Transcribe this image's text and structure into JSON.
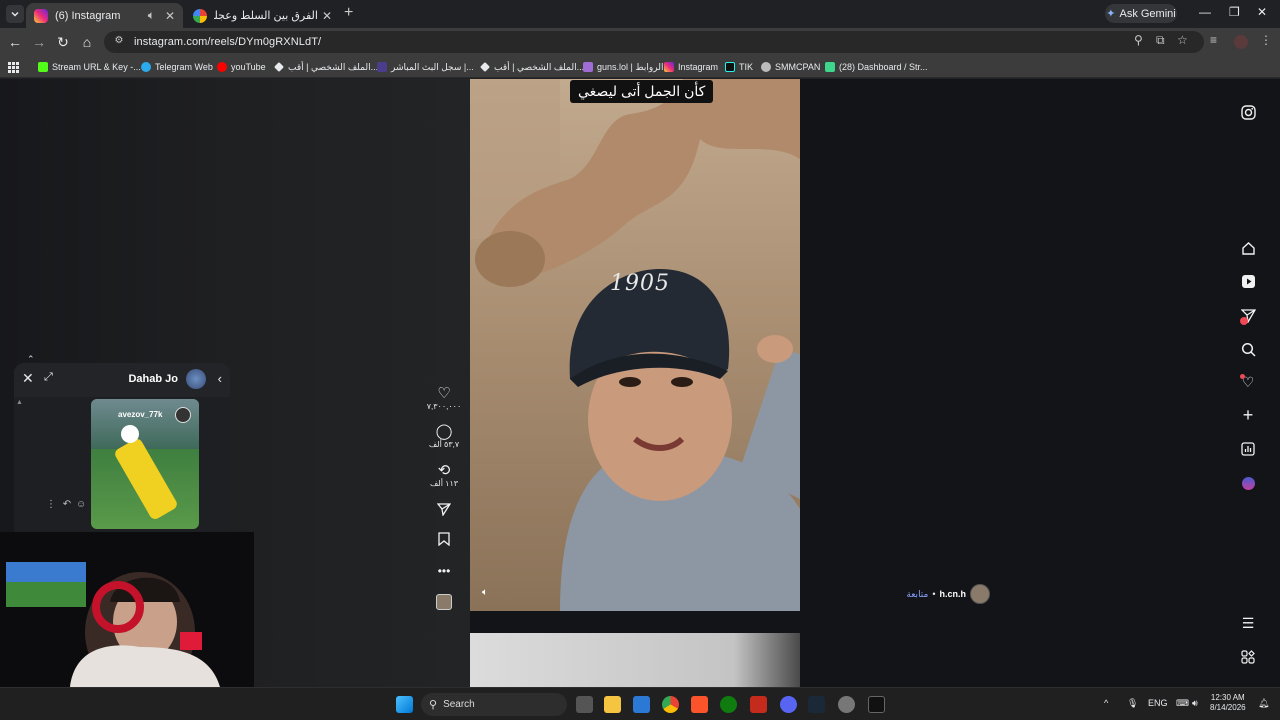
{
  "browser": {
    "tabs": [
      {
        "title": "(6) Instagram",
        "active": true
      },
      {
        "title": "الفرق بين السلط وعجلون - بحث",
        "active": false
      }
    ],
    "ask_gemini": "Ask Gemini",
    "url": "instagram.com/reels/DYm0gRXNLdT/",
    "bookmarks": [
      "Stream URL & Key -...",
      "Telegram Web",
      "youTube",
      "الملف الشخصي | أقب...",
      "سجل البث المباشر |...",
      "الملف الشخصي | أقب...",
      "guns.lol | الروابط",
      "Instagram",
      "TIK",
      "SMMCPAN",
      "(28) Dashboard / Str..."
    ]
  },
  "reel": {
    "caption": "كأن الجمل أتى ليصغي",
    "cap_logo": "1905",
    "actions": {
      "likes": "٧,٣٠٠,٠٠٠",
      "comments": "٥٣,٧ ألف",
      "reposts": "١١٣ ألف"
    },
    "author": {
      "name": "h.cn.h",
      "separator": "•",
      "follow": "متابعة"
    }
  },
  "chat": {
    "title": "Dahab Jo",
    "shared_post_user": "avezov_77k"
  },
  "taskbar": {
    "search_placeholder": "Search",
    "language": "ENG",
    "time": "12:30 AM",
    "date": "8/14/2026"
  },
  "colors": {
    "page_bg": "#131418",
    "accent_blue": "#8aa0ff",
    "notification_red": "#ed4956"
  },
  "icons": {
    "right_nav": [
      "instagram-icon",
      "home-icon",
      "reels-icon",
      "messages-icon",
      "search-icon",
      "notifications-icon",
      "create-icon",
      "dashboard-icon",
      "profile-icon",
      "menu-icon",
      "more-icon"
    ]
  }
}
